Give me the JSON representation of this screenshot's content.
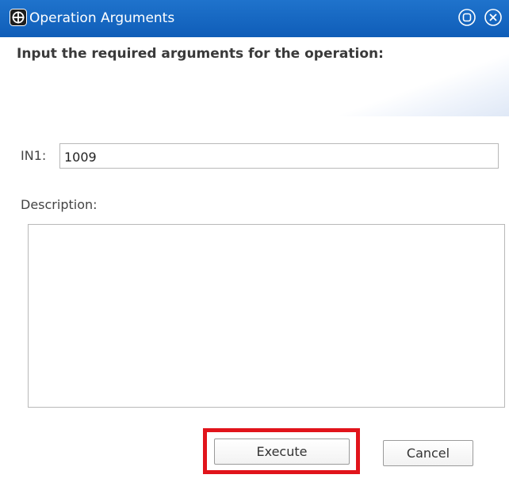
{
  "window": {
    "title": "Operation Arguments",
    "icon": "operation-icon",
    "controls": [
      "restore-icon",
      "close-icon"
    ],
    "title_bar_color": "#1565c0"
  },
  "form": {
    "header": "Input the required arguments for the operation:",
    "in1_label": "IN1:",
    "in1_value": "1009",
    "description_label": "Description:",
    "description_value": ""
  },
  "buttons": {
    "execute_label": "Execute",
    "cancel_label": "Cancel"
  },
  "annotation": {
    "highlight_color": "#e1141b"
  }
}
